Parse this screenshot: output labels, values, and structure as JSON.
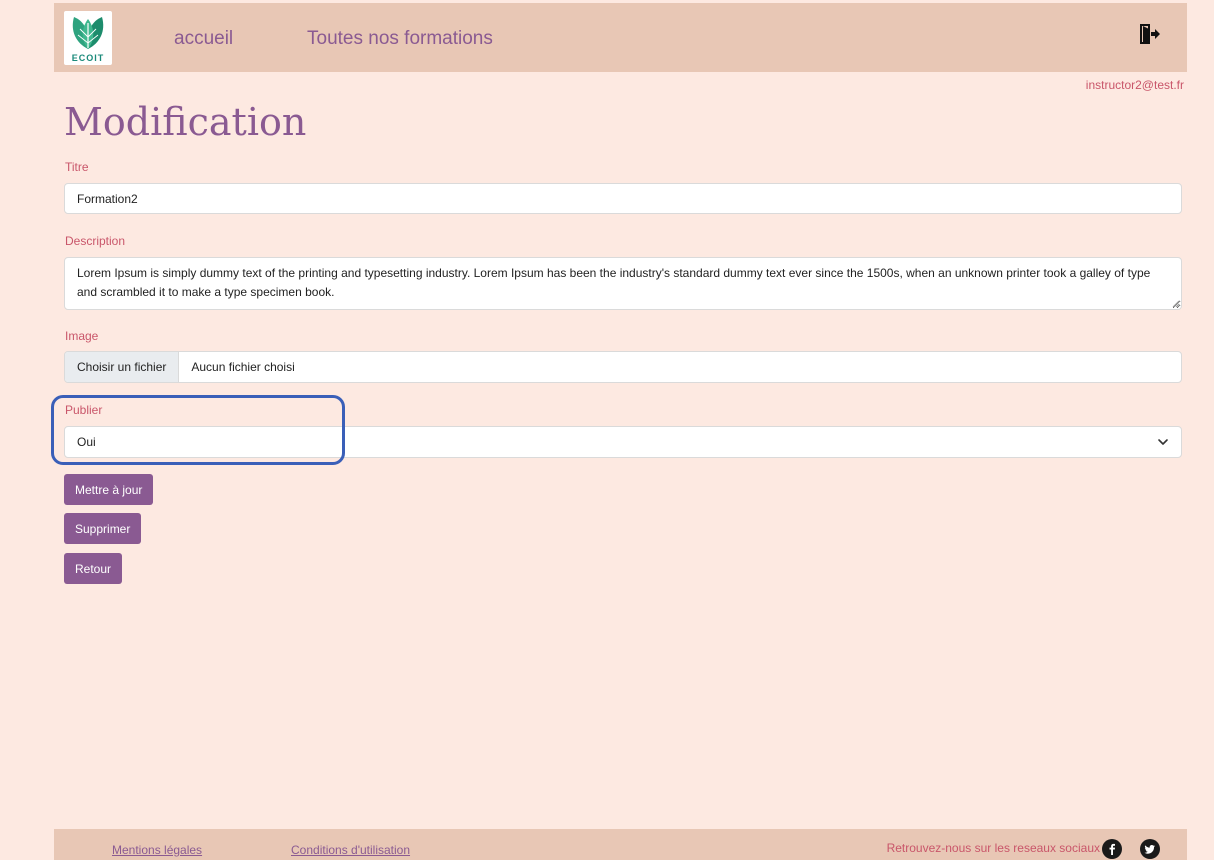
{
  "brand": {
    "logo_text": "ECOIT"
  },
  "nav": {
    "home": "accueil",
    "all_courses": "Toutes nos formations"
  },
  "user": {
    "email": "instructor2@test.fr"
  },
  "page": {
    "title": "Modification"
  },
  "form": {
    "title_label": "Titre",
    "title_value": "Formation2",
    "description_label": "Description",
    "description_value": "Lorem Ipsum is simply dummy text of the printing and typesetting industry. Lorem Ipsum has been the industry's standard dummy text ever since the 1500s, when an unknown printer took a galley of type and scrambled it to make a type specimen book.",
    "image_label": "Image",
    "file_button": "Choisir un fichier",
    "file_status": "Aucun fichier choisi",
    "publish_label": "Publier",
    "publish_value": "Oui"
  },
  "buttons": {
    "update": "Mettre à jour",
    "delete": "Supprimer",
    "back": "Retour"
  },
  "footer": {
    "legal": "Mentions légales",
    "terms": "Conditions d'utilisation",
    "social_text": "Retrouvez-nous sur les reseaux sociaux"
  },
  "icons": {
    "logout": "logout-icon",
    "facebook": "facebook-icon",
    "twitter": "twitter-icon",
    "select_chevron": "chevron-down-icon",
    "logo": "leaf-logo-icon"
  },
  "colors": {
    "background": "#fde9e1",
    "navbar": "#e8c7b5",
    "accent": "#8a5a92",
    "label": "#c9566a",
    "highlight": "#3a5fb8"
  }
}
